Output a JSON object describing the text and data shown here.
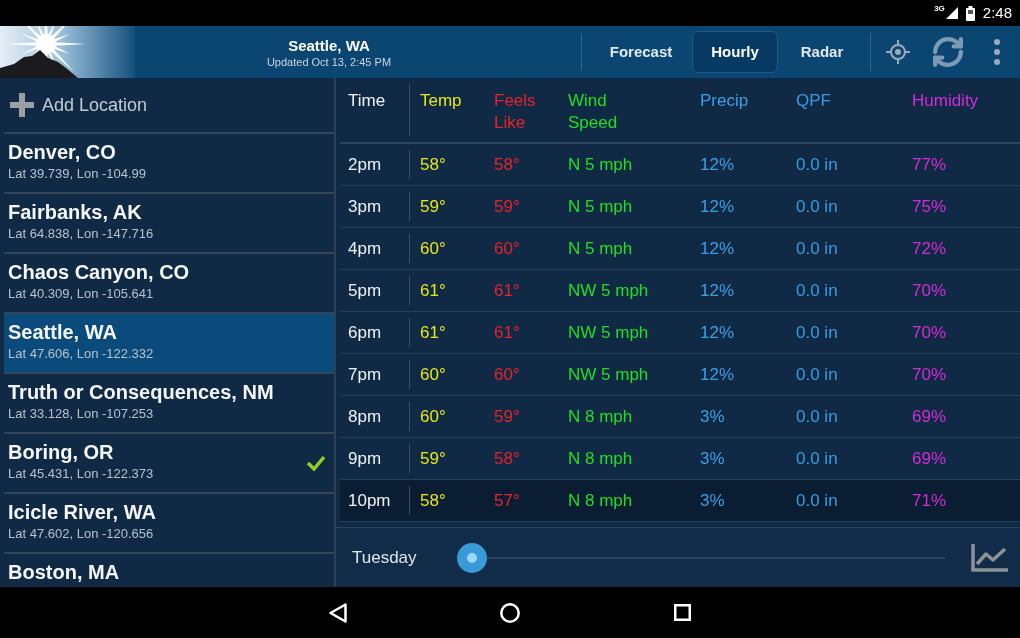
{
  "status_bar": {
    "network": "3G",
    "time": "2:48"
  },
  "app_bar": {
    "title": "Seattle, WA",
    "subtitle": "Updated Oct 13, 2:45 PM",
    "tabs": [
      {
        "label": "Forecast",
        "selected": false
      },
      {
        "label": "Hourly",
        "selected": true
      },
      {
        "label": "Radar",
        "selected": false
      }
    ]
  },
  "sidebar": {
    "add_label": "Add Location",
    "locations": [
      {
        "name": "Denver, CO",
        "coords": "Lat 39.739, Lon -104.99",
        "selected": false,
        "checked": false
      },
      {
        "name": "Fairbanks, AK",
        "coords": "Lat 64.838, Lon -147.716",
        "selected": false,
        "checked": false
      },
      {
        "name": "Chaos Canyon, CO",
        "coords": "Lat 40.309, Lon -105.641",
        "selected": false,
        "checked": false
      },
      {
        "name": "Seattle, WA",
        "coords": "Lat 47.606, Lon -122.332",
        "selected": true,
        "checked": false
      },
      {
        "name": "Truth or Consequences, NM",
        "coords": "Lat 33.128, Lon -107.253",
        "selected": false,
        "checked": false
      },
      {
        "name": "Boring, OR",
        "coords": "Lat 45.431, Lon -122.373",
        "selected": false,
        "checked": true
      },
      {
        "name": "Icicle River, WA",
        "coords": "Lat 47.602, Lon -120.656",
        "selected": false,
        "checked": false
      },
      {
        "name": "Boston, MA",
        "selected": false,
        "checked": false
      }
    ]
  },
  "table": {
    "columns": [
      {
        "label": "Time",
        "color": "#eef2f6"
      },
      {
        "label": "Temp",
        "color": "#e6e61c"
      },
      {
        "label": "Feels Like",
        "color": "#e6222c"
      },
      {
        "label": "Wind Speed",
        "color": "#22dd22"
      },
      {
        "label": "Precip",
        "color": "#3d9fe6"
      },
      {
        "label": "QPF",
        "color": "#3a9ae0"
      },
      {
        "label": "Humidity",
        "color": "#d22cd6"
      }
    ],
    "rows": [
      {
        "selected": false,
        "cells": [
          "2pm",
          "58°",
          "58°",
          "N 5 mph",
          "12%",
          "0.0 in",
          "77%"
        ]
      },
      {
        "selected": false,
        "cells": [
          "3pm",
          "59°",
          "59°",
          "N 5 mph",
          "12%",
          "0.0 in",
          "75%"
        ]
      },
      {
        "selected": false,
        "cells": [
          "4pm",
          "60°",
          "60°",
          "N 5 mph",
          "12%",
          "0.0 in",
          "72%"
        ]
      },
      {
        "selected": false,
        "cells": [
          "5pm",
          "61°",
          "61°",
          "NW 5 mph",
          "12%",
          "0.0 in",
          "70%"
        ]
      },
      {
        "selected": false,
        "cells": [
          "6pm",
          "61°",
          "61°",
          "NW 5 mph",
          "12%",
          "0.0 in",
          "70%"
        ]
      },
      {
        "selected": false,
        "cells": [
          "7pm",
          "60°",
          "60°",
          "NW 5 mph",
          "12%",
          "0.0 in",
          "70%"
        ]
      },
      {
        "selected": false,
        "cells": [
          "8pm",
          "60°",
          "59°",
          "N 8 mph",
          "3%",
          "0.0 in",
          "69%"
        ]
      },
      {
        "selected": false,
        "cells": [
          "9pm",
          "59°",
          "58°",
          "N 8 mph",
          "3%",
          "0.0 in",
          "69%"
        ]
      },
      {
        "selected": true,
        "cells": [
          "10pm",
          "58°",
          "57°",
          "N 8 mph",
          "3%",
          "0.0 in",
          "71%"
        ]
      }
    ]
  },
  "day_slider": {
    "label": "Tuesday",
    "level": 0
  }
}
